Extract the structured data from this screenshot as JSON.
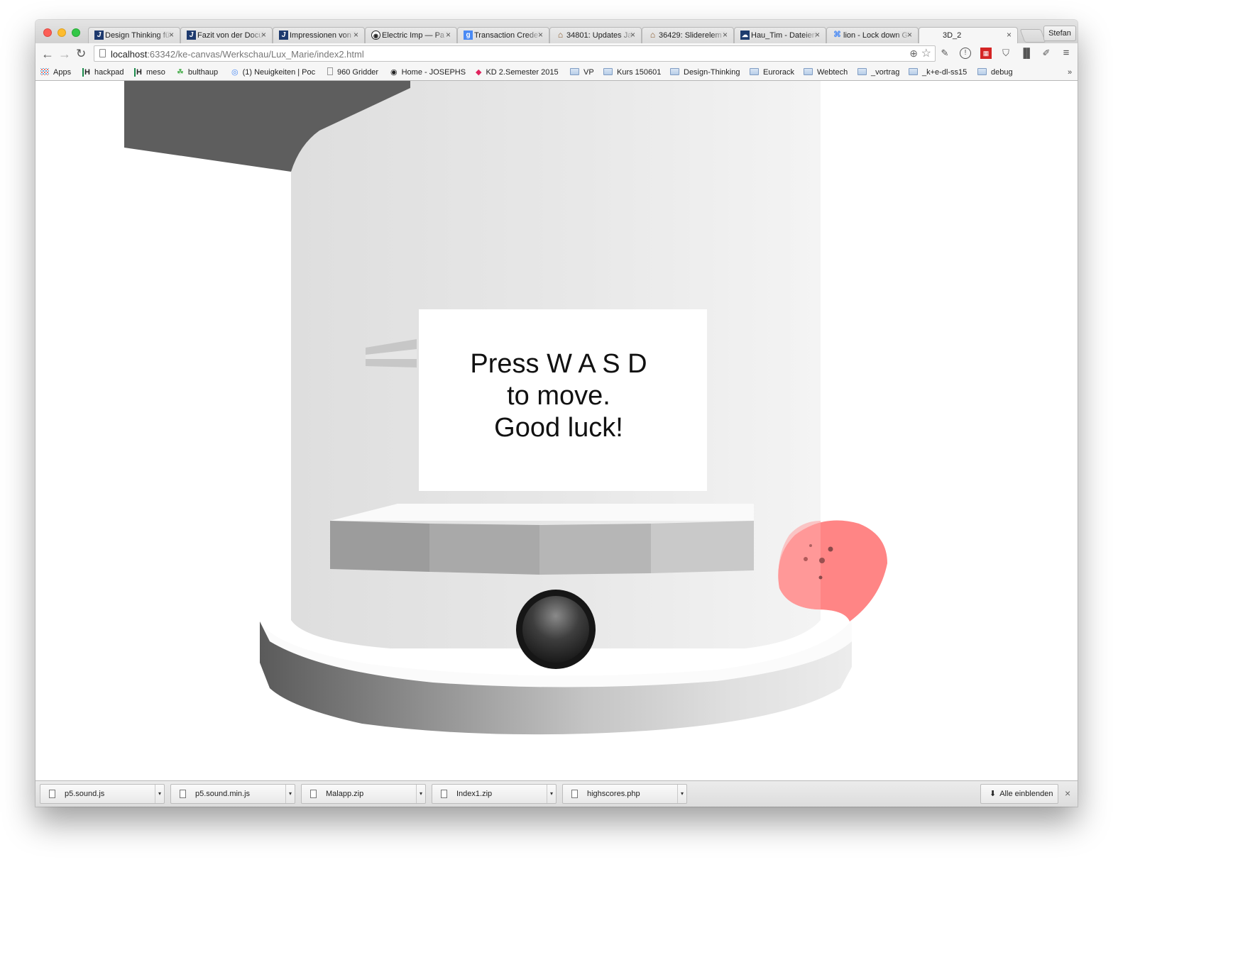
{
  "browser": {
    "profile_name": "Stefan",
    "tabs": [
      {
        "title": "Design Thinking fü",
        "icon": "J"
      },
      {
        "title": "Fazit von der Docu",
        "icon": "J"
      },
      {
        "title": "Impressionen von",
        "icon": "J"
      },
      {
        "title": "Electric Imp — Pa",
        "icon": "octocat"
      },
      {
        "title": "Transaction Crede",
        "icon": "g"
      },
      {
        "title": "34801: Updates Ja",
        "icon": "house"
      },
      {
        "title": "36429: Sliderelem",
        "icon": "house"
      },
      {
        "title": "Hau_Tim - Dateien",
        "icon": "cloud"
      },
      {
        "title": "lion - Lock down G",
        "icon": "cmd"
      },
      {
        "title": "3D_2",
        "icon": "",
        "active": true
      }
    ],
    "url_host": "localhost",
    "url_rest": ":63342/ke-canvas/Werkschau/Lux_Marie/index2.html"
  },
  "bookmarks": [
    {
      "label": "Apps",
      "type": "apps"
    },
    {
      "label": "hackpad",
      "type": "h"
    },
    {
      "label": "meso",
      "type": "h"
    },
    {
      "label": "bulthaup",
      "type": "leaf"
    },
    {
      "label": "(1) Neuigkeiten | Poc",
      "type": "pin"
    },
    {
      "label": "960 Gridder",
      "type": "page"
    },
    {
      "label": "Home - JOSEPHS",
      "type": "circle"
    },
    {
      "label": "KD 2.Semester 2015",
      "type": "pink"
    },
    {
      "label": "VP",
      "type": "folder"
    },
    {
      "label": "Kurs 150601",
      "type": "folder"
    },
    {
      "label": "Design-Thinking",
      "type": "folder"
    },
    {
      "label": "Eurorack",
      "type": "folder"
    },
    {
      "label": "Webtech",
      "type": "folder"
    },
    {
      "label": "_vortrag",
      "type": "folder"
    },
    {
      "label": "_k+e-dl-ss15",
      "type": "folder"
    },
    {
      "label": "debug",
      "type": "folder"
    }
  ],
  "bookmarks_overflow": "»",
  "game": {
    "message_lines": [
      "Press W A S D",
      "to move.",
      "Good luck!"
    ],
    "colors": {
      "background": "#ffffff",
      "tower": "#e2e2e2",
      "ball": "#3a3a3a",
      "enemy": "#ff8080"
    }
  },
  "downloads": {
    "items": [
      "p5.sound.js",
      "p5.sound.min.js",
      "Malapp.zip",
      "Index1.zip",
      "highscores.php"
    ],
    "show_all_label": "Alle einblenden",
    "close_label": "×"
  }
}
